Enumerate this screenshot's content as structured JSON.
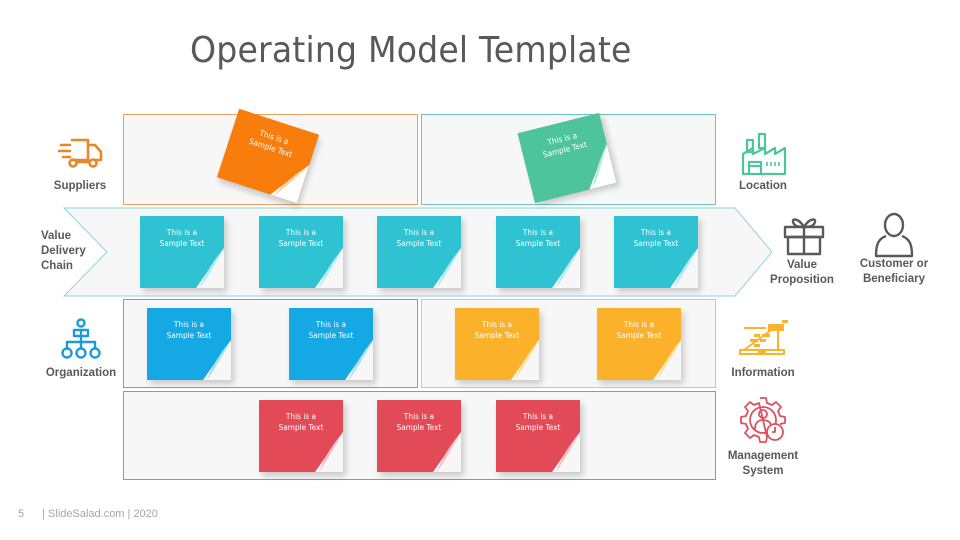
{
  "title": "Operating Model Template",
  "colors": {
    "orange": "#f87d0c",
    "green": "#4ec49c",
    "teal": "#2ec2d2",
    "blue": "#14a8e4",
    "yellow": "#fbb22a",
    "red": "#e34a58",
    "text": "#595959",
    "panel_bg": "#f7f7f7"
  },
  "note_text": "This is a Sample Text",
  "note_line1": "This is a",
  "note_line2": "Sample Text",
  "labels": {
    "suppliers": "Suppliers",
    "value_delivery_chain": [
      "Value",
      "Delivery",
      "Chain"
    ],
    "organization": "Organization",
    "location": "Location",
    "value_proposition": [
      "Value",
      "Proposition"
    ],
    "customer": [
      "Customer or",
      "Beneficiary"
    ],
    "information": "Information",
    "management_system": [
      "Management",
      "System"
    ]
  },
  "rows": {
    "suppliers_notes": 1,
    "location_notes": 1,
    "value_chain_notes": 5,
    "organization_notes": 2,
    "information_notes": 2,
    "management_notes": 3
  },
  "footer": {
    "page": "5",
    "text": "| SlideSalad.com | 2020"
  }
}
